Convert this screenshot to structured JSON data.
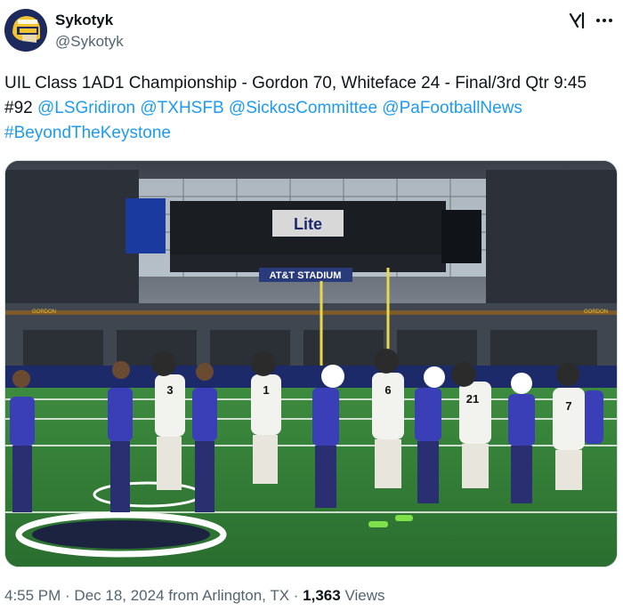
{
  "author": {
    "display_name": "Sykotyk",
    "handle": "@Sykotyk",
    "avatar_icon": "helmet-avatar-icon"
  },
  "header_icons": {
    "grok": "grok-icon",
    "more": "more-options-icon"
  },
  "tweet": {
    "text_plain": "UIL Class 1AD1 Championship - Gordon 70, Whiteface 24 - Final/3rd Qtr 9:45 #92 ",
    "links": [
      "@LSGridiron",
      "@TXHSFB",
      "@SickosCommittee",
      "@PaFootballNews",
      "#BeyondTheKeystone"
    ]
  },
  "photo": {
    "scoreboard_brand": "Lite",
    "stadium_sign": "AT&T STADIUM",
    "banner_left": "GORDON",
    "banner_right": "GORDON"
  },
  "meta": {
    "time": "4:55 PM",
    "date": "Dec 18, 2024",
    "location": "from Arlington, TX",
    "views_count": "1,363",
    "views_label": "Views"
  },
  "colors": {
    "link": "#1d9bf0",
    "secondary_text": "#536471",
    "field_green": "#2f7a34",
    "blue_jersey": "#3a3fb8"
  }
}
